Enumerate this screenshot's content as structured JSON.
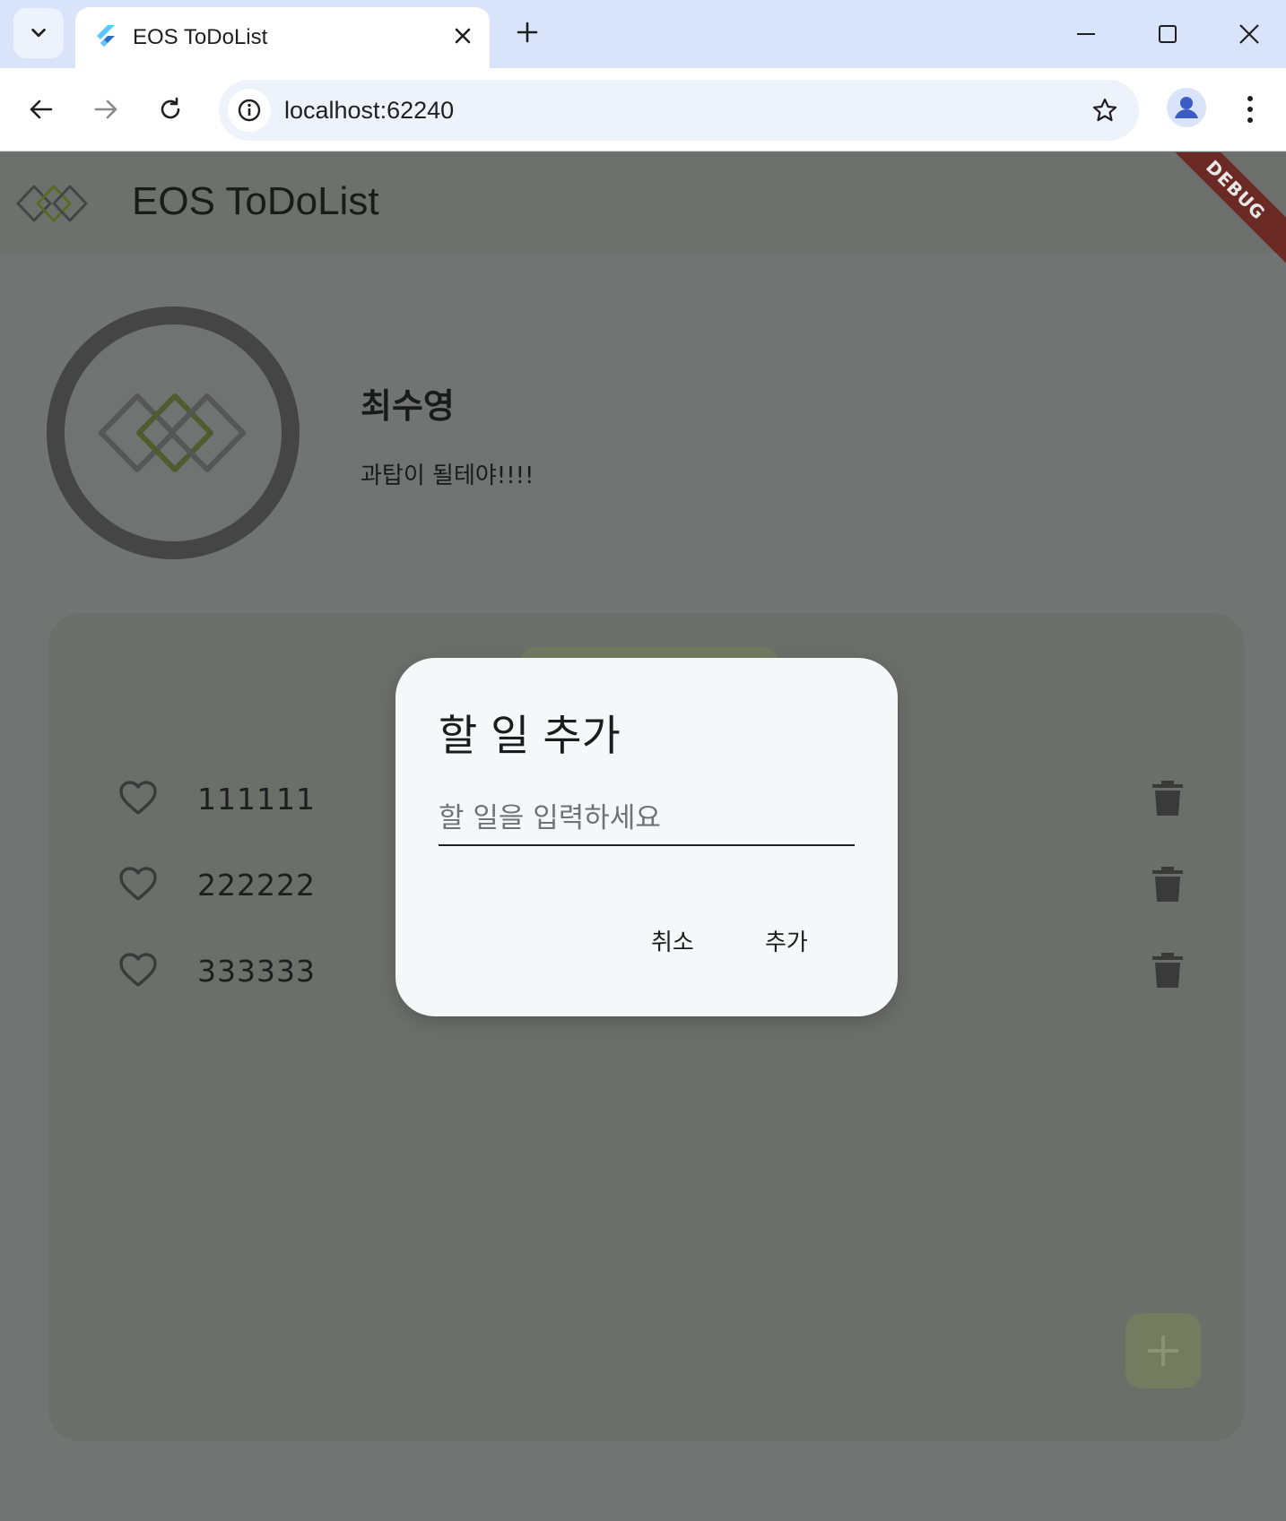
{
  "browser": {
    "tab_title": "EOS ToDoList",
    "url": "localhost:62240",
    "icons": [
      "tab-search-icon",
      "flutter-favicon-icon",
      "close-icon",
      "plus-icon",
      "minimize-icon",
      "maximize-icon",
      "close-window-icon",
      "back-arrow-icon",
      "forward-arrow-icon",
      "reload-icon",
      "info-icon",
      "star-icon",
      "profile-icon",
      "more-vert-icon"
    ]
  },
  "app": {
    "title": "EOS ToDoList",
    "debug_banner": "DEBUG",
    "profile": {
      "name": "최수영",
      "status": "과탑이 될테야!!!!"
    },
    "todos": [
      {
        "text": "111111",
        "liked": false
      },
      {
        "text": "222222",
        "liked": false
      },
      {
        "text": "333333",
        "liked": false
      }
    ]
  },
  "dialog": {
    "title": "할 일 추가",
    "input_placeholder": "할 일을 입력하세요",
    "input_value": "",
    "cancel_label": "취소",
    "add_label": "추가"
  },
  "colors": {
    "browser_tabstrip": "#d9e3fa",
    "scrim_background": "#727473",
    "dialog_background": "#f4f8f8",
    "logo_accent": "#5a6a22",
    "debug_banner": "#6b2a24"
  }
}
